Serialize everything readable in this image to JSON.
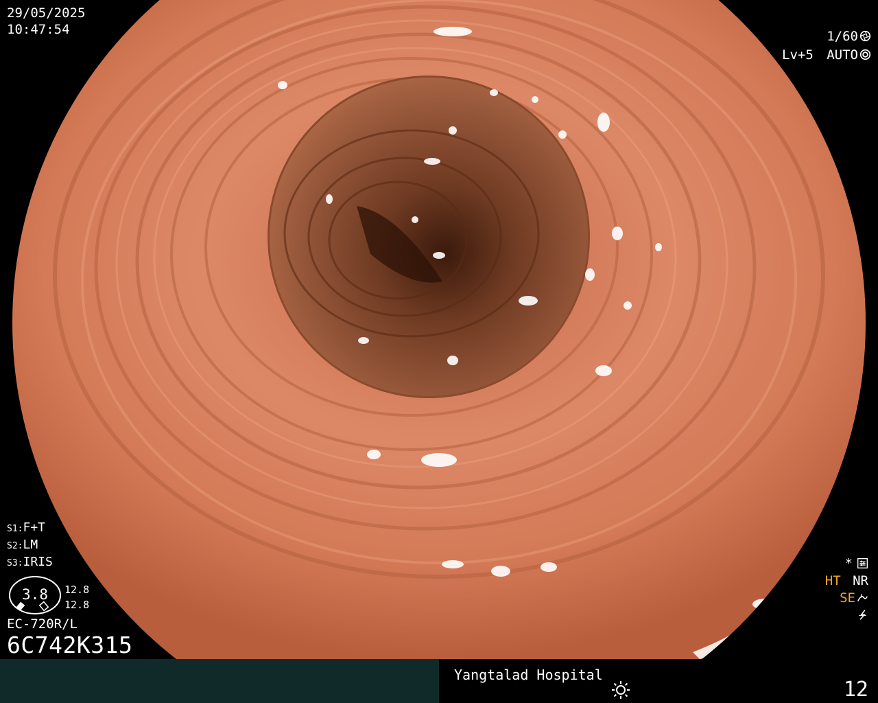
{
  "overlay": {
    "date": "29/05/2025",
    "time": "10:47:54",
    "shutter": "1/60",
    "level": "Lv+5",
    "auto": "AUTO"
  },
  "settings": {
    "s1": {
      "key": "S1:",
      "value": "F+T"
    },
    "s2": {
      "key": "S2:",
      "value": "LM"
    },
    "s3": {
      "key": "S3:",
      "value": "IRIS"
    }
  },
  "scope": {
    "circle_value": "3.8",
    "side_value_1": "12.8",
    "side_value_2": "12.8",
    "model": "EC-720R/L",
    "serial": "6C742K315"
  },
  "modes": {
    "star": "*",
    "ht": "HT",
    "nr": "NR",
    "se": "SE"
  },
  "footer": {
    "hospital": "Yangtalad Hospital",
    "page_number": "12"
  },
  "colors": {
    "footer_left_bg": "#102a2a",
    "mode_highlight": "#f5a623",
    "mucosa": "#d27a5c"
  },
  "icons": [
    "shutter-icon",
    "auto-iris-icon",
    "settings-icon",
    "se-icon",
    "lightning-icon",
    "brightness-icon"
  ]
}
